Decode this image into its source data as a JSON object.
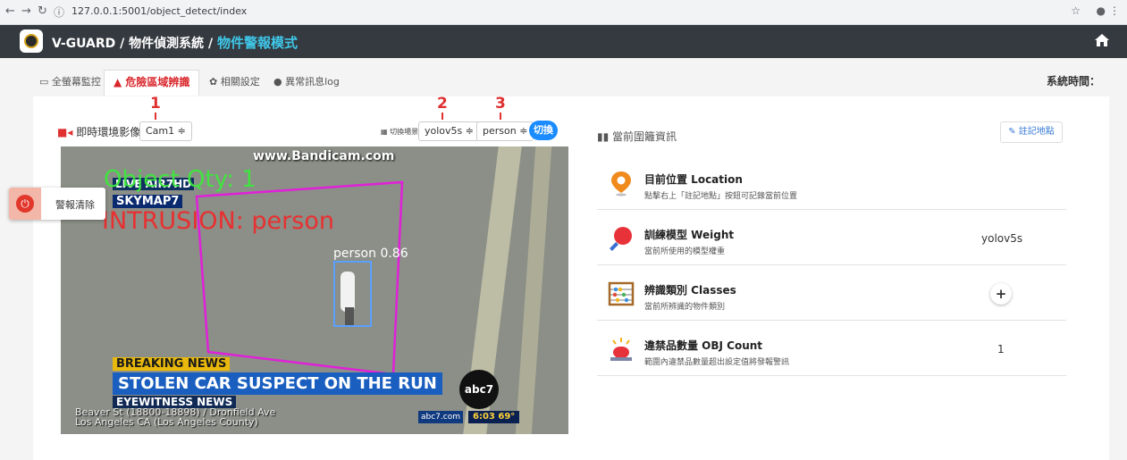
{
  "browser": {
    "url": "127.0.0.1:5001/object_detect/index"
  },
  "brand": {
    "name": "V-GUARD / 物件偵測系統 / ",
    "mode": "物件警報模式"
  },
  "tabs": [
    {
      "label": "全螢幕監控",
      "icon": "monitor-icon"
    },
    {
      "label": "危險區域辨識",
      "icon": "warning-icon",
      "active": true
    },
    {
      "label": "相關設定",
      "icon": "gear-icon"
    },
    {
      "label": "異常訊息log",
      "icon": "chat-icon"
    }
  ],
  "system_time_label": "系統時間：",
  "annotations": [
    "1",
    "2",
    "3"
  ],
  "camera": {
    "label": "即時環境影像",
    "select": "Cam1 ≑"
  },
  "scene": {
    "label": "切換場景",
    "model_select": "yolov5s ≑",
    "class_select": "person ≑",
    "switch_label": "切換"
  },
  "video": {
    "watermark": "www.Bandicam.com",
    "overlay_qty": "Object Qty: 1",
    "overlay_intrusion": "INTRUSION: person",
    "detection_label": "person  0.86",
    "live_badge": "LIVE AIR7HD",
    "skymap": "SKYMAP7",
    "breaking": "BREAKING NEWS",
    "headline": "STOLEN CAR SUSPECT ON THE RUN",
    "eyewitness": "EYEWITNESS NEWS",
    "address": "Beaver St (18800-18898) / Dronfield Ave Los Angeles CA (Los Angeles County)",
    "abc_logo": "abc7",
    "abc_site": "abc7.com",
    "abc_time": "6:03  69°"
  },
  "alarm": {
    "label": "警報清除"
  },
  "right_panel": {
    "title": "當前圍籬資訊",
    "mark_button": "註記地點",
    "rows": [
      {
        "title": "目前位置 Location",
        "desc": "點擊右上「註記地點」按鈕可記錄當前位置",
        "value": "",
        "icon": "location-pin-icon"
      },
      {
        "title": "訓練模型 Weight",
        "desc": "當前所使用的模型權重",
        "value": "yolov5s",
        "icon": "magnifier-icon"
      },
      {
        "title": "辨識類別 Classes",
        "desc": "當前所辨識的物件類別",
        "value": "+",
        "icon": "abacus-icon"
      },
      {
        "title": "違禁品數量 OBJ Count",
        "desc": "範圍內違禁品數量超出設定值將發報警訊",
        "value": "1",
        "icon": "siren-icon"
      }
    ]
  },
  "colors": {
    "navbar": "#343a40",
    "accent": "#3fc7e8",
    "danger": "#d9262b",
    "primary": "#1a8cff"
  }
}
